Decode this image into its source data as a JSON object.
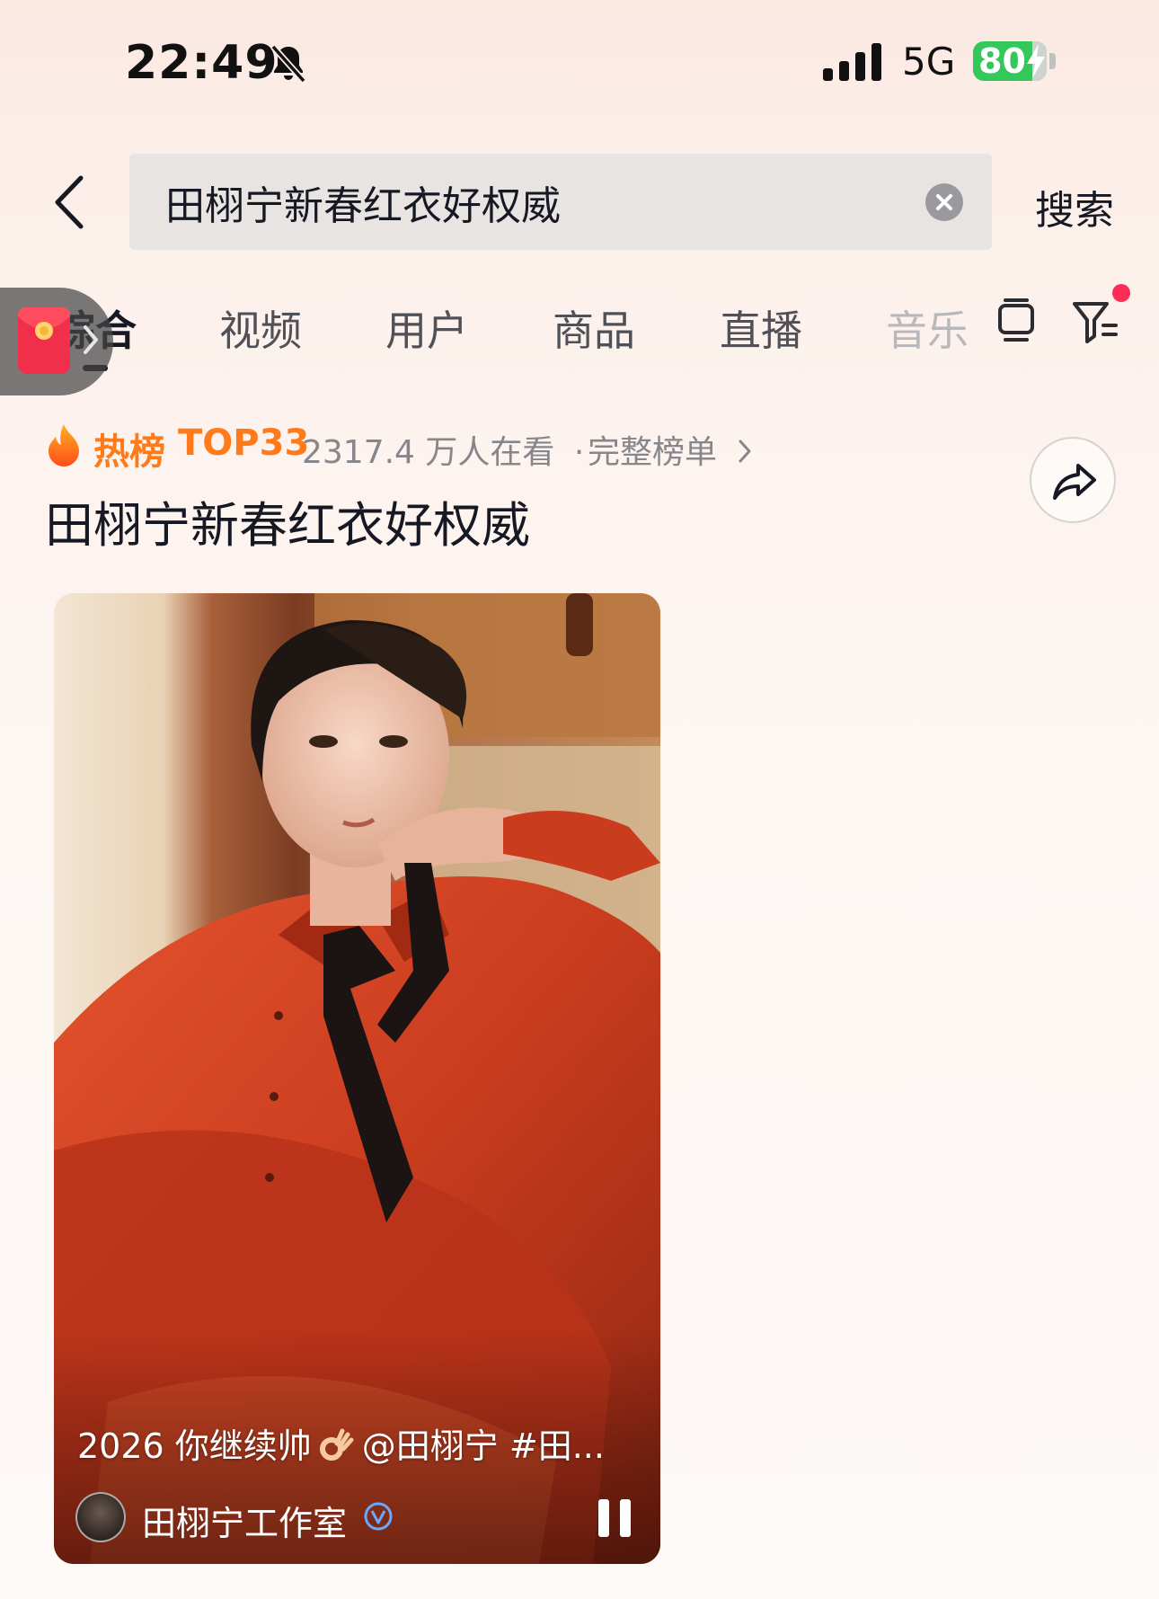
{
  "status_bar": {
    "time": "22:49",
    "network": "5G",
    "battery": "80"
  },
  "search": {
    "query": "田栩宁新春红衣好权威",
    "button_label": "搜索"
  },
  "tabs": [
    {
      "label": "综合",
      "active": true
    },
    {
      "label": "视频"
    },
    {
      "label": "用户"
    },
    {
      "label": "商品"
    },
    {
      "label": "直播"
    },
    {
      "label": "音乐"
    }
  ],
  "hot": {
    "label": "热榜",
    "rank": "TOP33",
    "viewers": "2317.4 万人在看",
    "separator": "·",
    "full_list": "完整榜单"
  },
  "topic_title": "田栩宁新春红衣好权威",
  "video": {
    "caption_prefix": "2026 你继续帅",
    "caption_suffix": "@田栩宁  #田...",
    "author": "田栩宁工作室"
  },
  "colors": {
    "hot_orange": "#ff7a1a",
    "accent_red": "#fe2c55",
    "battery_green": "#34c759"
  }
}
